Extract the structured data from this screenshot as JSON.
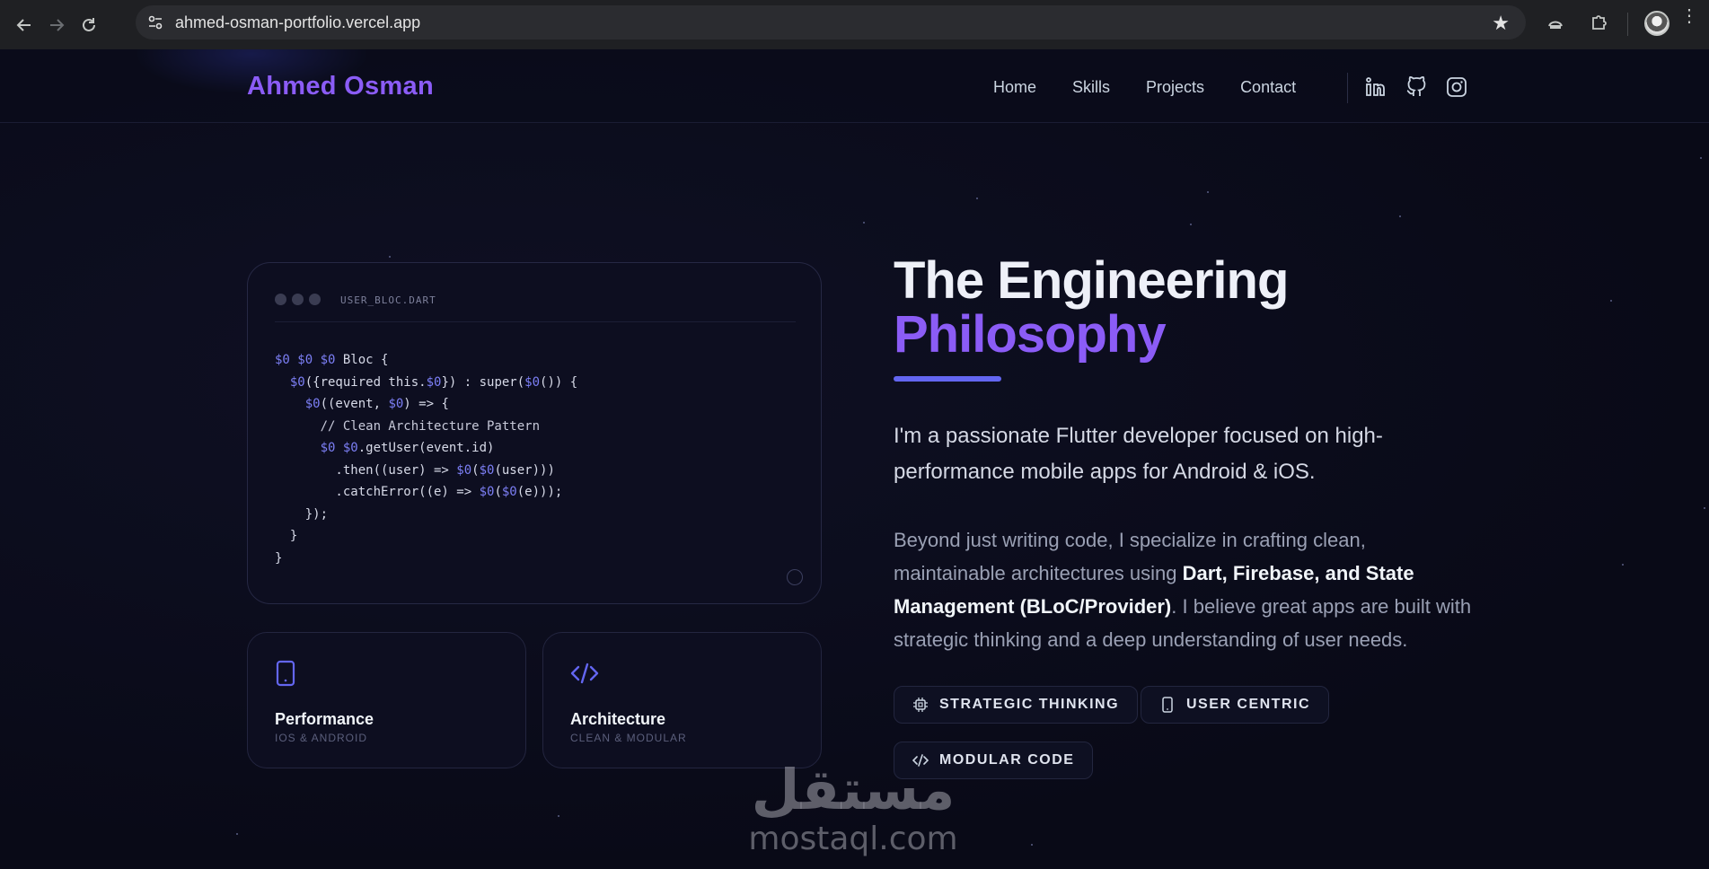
{
  "browser": {
    "url": "ahmed-osman-portfolio.vercel.app",
    "icons": [
      "back-icon",
      "forward-icon",
      "reload-icon",
      "site-settings-icon",
      "bookmark-star-icon",
      "extension-icon",
      "puzzle-icon",
      "profile-avatar",
      "menu-icon"
    ]
  },
  "header": {
    "logo": "Ahmed Osman",
    "nav": [
      "Home",
      "Skills",
      "Projects",
      "Contact"
    ],
    "social_icons": [
      "linkedin-icon",
      "github-icon",
      "instagram-icon"
    ]
  },
  "code_card": {
    "filename": "USER_BLOC.DART",
    "lines": [
      [
        {
          "t": "$0 $0 $0",
          "c": "kw"
        },
        {
          "t": " Bloc {",
          "c": ""
        }
      ],
      [
        {
          "t": "  ",
          "c": ""
        },
        {
          "t": "$0",
          "c": "kw"
        },
        {
          "t": "({required this.",
          "c": ""
        },
        {
          "t": "$0",
          "c": "kw"
        },
        {
          "t": "}) : super(",
          "c": ""
        },
        {
          "t": "$0",
          "c": "kw"
        },
        {
          "t": "()) {",
          "c": ""
        }
      ],
      [
        {
          "t": "    ",
          "c": ""
        },
        {
          "t": "$0",
          "c": "kw"
        },
        {
          "t": "((event, ",
          "c": ""
        },
        {
          "t": "$0",
          "c": "kw"
        },
        {
          "t": ") => {",
          "c": ""
        }
      ],
      [
        {
          "t": "      // Clean Architecture Pattern",
          "c": "cm"
        }
      ],
      [
        {
          "t": "      ",
          "c": ""
        },
        {
          "t": "$0 $0",
          "c": "kw"
        },
        {
          "t": ".getUser(event.id)",
          "c": ""
        }
      ],
      [
        {
          "t": "        .then((user) => ",
          "c": ""
        },
        {
          "t": "$0",
          "c": "kw"
        },
        {
          "t": "(",
          "c": ""
        },
        {
          "t": "$0",
          "c": "kw"
        },
        {
          "t": "(user)))",
          "c": ""
        }
      ],
      [
        {
          "t": "        .catchError((e) => ",
          "c": ""
        },
        {
          "t": "$0",
          "c": "kw"
        },
        {
          "t": "(",
          "c": ""
        },
        {
          "t": "$0",
          "c": "kw"
        },
        {
          "t": "(e)));",
          "c": ""
        }
      ],
      [
        {
          "t": "    });",
          "c": ""
        }
      ],
      [
        {
          "t": "  }",
          "c": ""
        }
      ],
      [
        {
          "t": "}",
          "c": ""
        }
      ]
    ]
  },
  "features": [
    {
      "title": "Performance",
      "subtitle": "IOS & ANDROID",
      "icon": "smartphone-icon"
    },
    {
      "title": "Architecture",
      "subtitle": "CLEAN & MODULAR",
      "icon": "code-icon"
    }
  ],
  "about": {
    "heading_line1": "The Engineering",
    "heading_line2": "Philosophy",
    "lead": "I'm a passionate Flutter developer focused on high-performance mobile apps for Android & iOS.",
    "body_pre": "Beyond just writing code, I specialize in crafting clean, maintainable architectures using ",
    "body_bold": "Dart, Firebase, and State Management (BLoC/Provider)",
    "body_post": ". I believe great apps are built with strategic thinking and a deep understanding of user needs.",
    "tags": [
      {
        "label": "STRATEGIC THINKING",
        "icon": "chip-icon"
      },
      {
        "label": "USER CENTRIC",
        "icon": "smartphone-icon"
      },
      {
        "label": "MODULAR CODE",
        "icon": "code-icon"
      }
    ]
  },
  "watermark": {
    "arabic": "مستقل",
    "latin": "mostaql.com"
  },
  "colors": {
    "accent": "#8b5cf6",
    "indigo": "#6366f1",
    "background": "#0a0b1a"
  }
}
